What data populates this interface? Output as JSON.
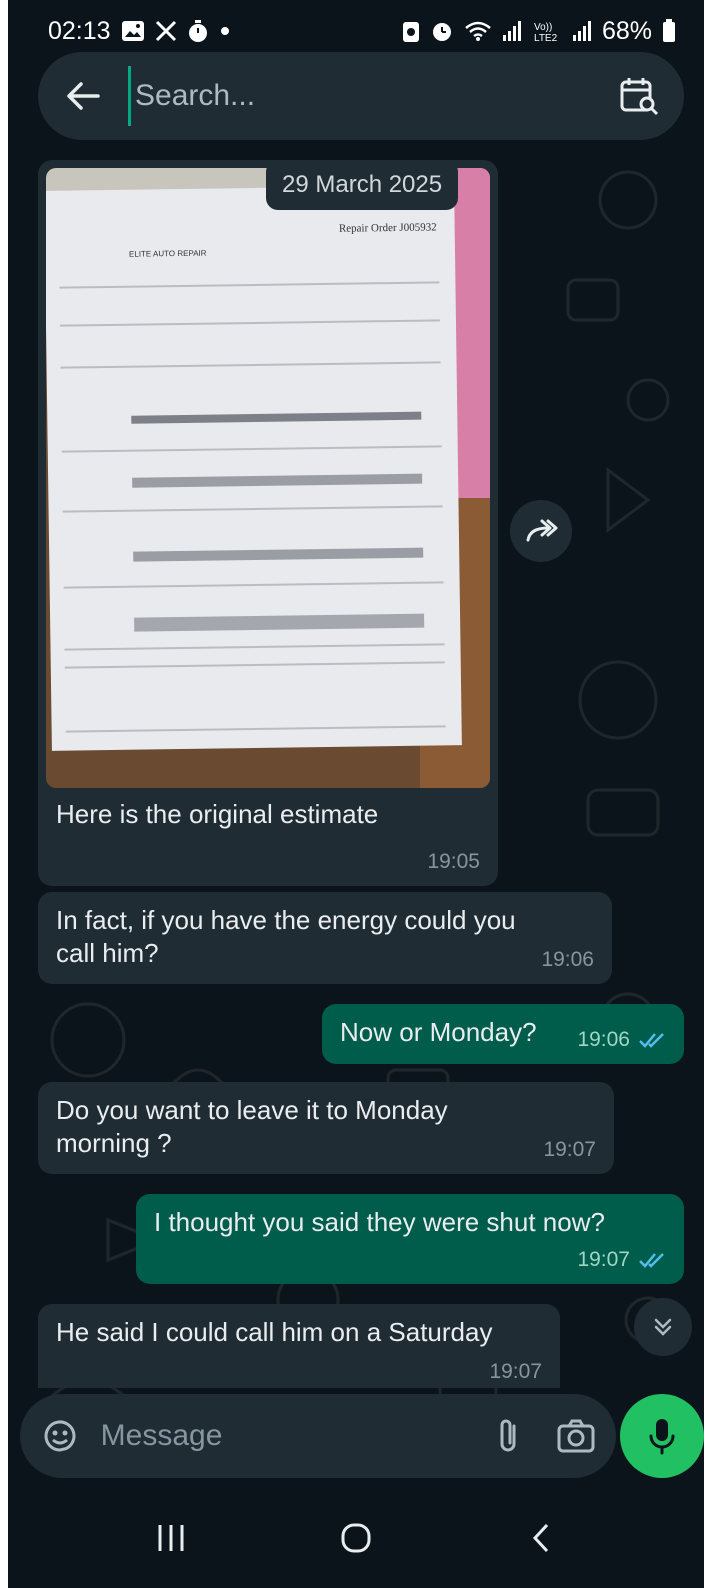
{
  "status_bar": {
    "time": "02:13",
    "battery": "68%",
    "left_icons": [
      "gallery-icon",
      "x-icon",
      "timer-icon",
      "dot-icon"
    ],
    "right_icons": [
      "battery-saver-icon",
      "alarm-icon",
      "wifi-icon",
      "signal-icon",
      "volte-icon",
      "signal-icon"
    ]
  },
  "search": {
    "placeholder": "Search..."
  },
  "chat": {
    "date_chip": "29 March 2025",
    "messages": [
      {
        "type": "image",
        "direction": "incoming",
        "caption": "Here is the original estimate",
        "time": "19:05",
        "image_text": {
          "title": "Repair Order J005932",
          "shop": "ELITE AUTO REPAIR"
        }
      },
      {
        "type": "text",
        "direction": "incoming",
        "text_line1": "In fact, if you have the energy could you",
        "text_line2": "call him?",
        "time": "19:06"
      },
      {
        "type": "text",
        "direction": "outgoing",
        "text": "Now or Monday?",
        "time": "19:06",
        "read": true
      },
      {
        "type": "text",
        "direction": "incoming",
        "text_line1": "Do you want to leave it to Monday",
        "text_line2": "morning ?",
        "time": "19:07"
      },
      {
        "type": "text",
        "direction": "outgoing",
        "text": "I thought you said they were shut now?",
        "time": "19:07",
        "read": true
      },
      {
        "type": "text",
        "direction": "incoming",
        "text": "He said I could call him on a Saturday",
        "time": "19:07"
      }
    ]
  },
  "composer": {
    "placeholder": "Message"
  },
  "colors": {
    "background": "#0b141a",
    "incoming_bubble": "#202c33",
    "outgoing_bubble": "#005c4b",
    "read_tick": "#53bdeb",
    "mic_button": "#21c063"
  }
}
